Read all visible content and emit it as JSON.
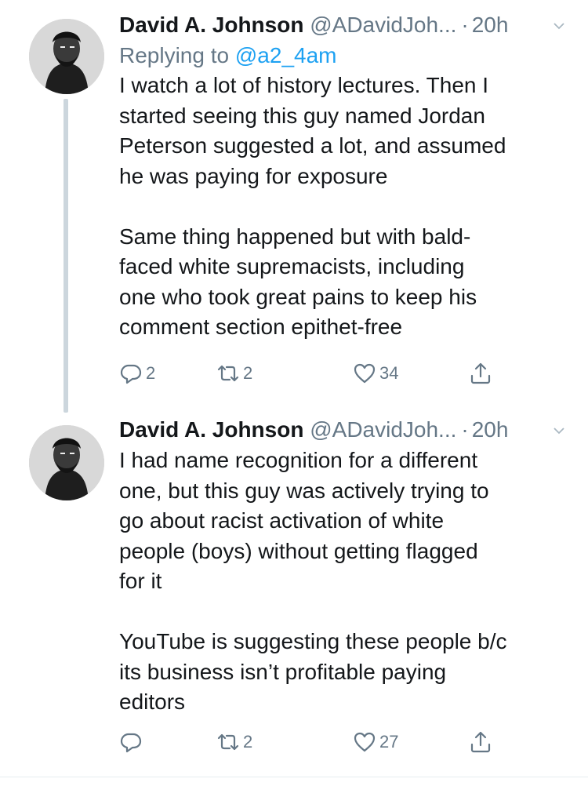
{
  "tweets": [
    {
      "author_name": "David A. Johnson",
      "author_handle": "@ADavidJoh...",
      "separator": "·",
      "time": "20h",
      "reply_prefix": "Replying to",
      "reply_mention": "@a2_4am",
      "text": "I watch a lot of history lectures. Then I\nstarted seeing this guy named Jordan\nPeterson suggested a lot, and assumed\nhe was paying for exposure\n\nSame thing happened but with bald-\nfaced white supremacists, including\none who took great pains to keep his\ncomment section epithet-free",
      "replies": "2",
      "retweets": "2",
      "likes": "34"
    },
    {
      "author_name": "David A. Johnson",
      "author_handle": "@ADavidJoh...",
      "separator": "·",
      "time": "20h",
      "text": "I had name recognition for a different\none, but this guy was actively trying to\ngo about racist activation of white\npeople (boys) without getting flagged\nfor it\n\nYouTube is suggesting these people b/c\nits business isn’t profitable paying\neditors",
      "retweets": "2",
      "likes": "27"
    }
  ],
  "icons": {
    "reply": "reply-icon",
    "retweet": "retweet-icon",
    "like": "heart-icon",
    "share": "share-icon",
    "caret": "chevron-down-icon"
  },
  "colors": {
    "text": "#14171a",
    "secondary": "#657786",
    "link": "#1da1f2",
    "thread_line": "#ccd6dd"
  }
}
